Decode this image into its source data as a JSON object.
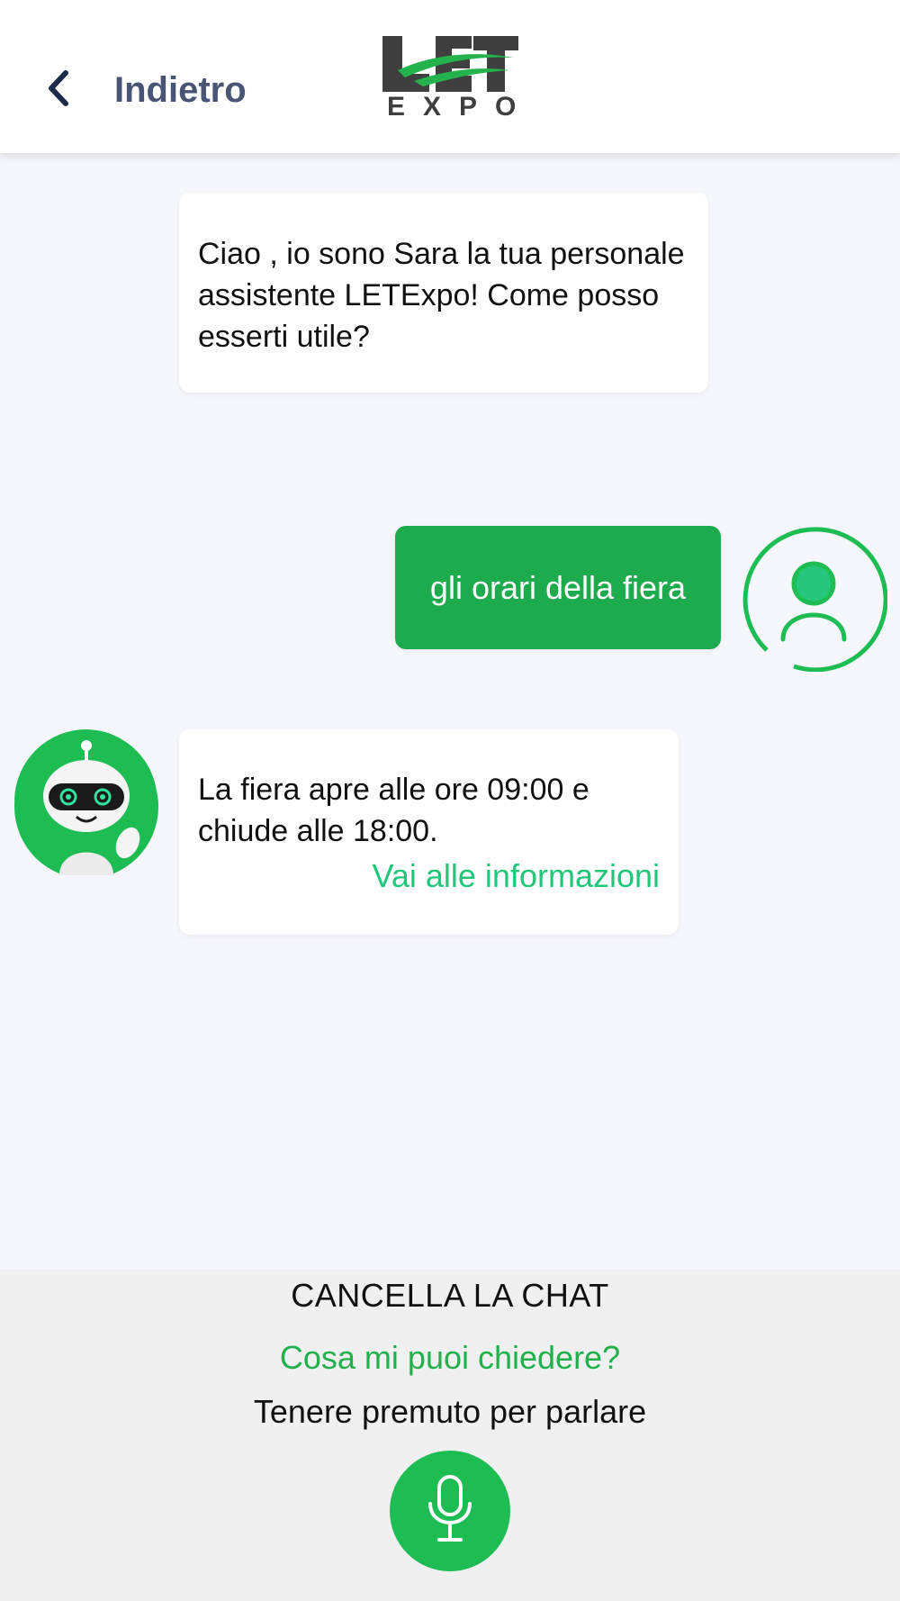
{
  "header": {
    "back_label": "Indietro",
    "logo_text": "LET",
    "logo_subtext": "EXPO"
  },
  "messages": [
    {
      "from": "bot",
      "text": "Ciao , io sono Sara la tua personale assistente LETExpo! Come posso esserti utile?"
    },
    {
      "from": "user",
      "text": "gli orari della fiera"
    },
    {
      "from": "bot",
      "text": "La fiera apre alle ore 09:00 e chiude alle 18:00.",
      "link": "Vai alle informazioni"
    }
  ],
  "footer": {
    "clear_chat": "CANCELLA LA CHAT",
    "ask_prompt": "Cosa mi puoi chiedere?",
    "hold_to_talk": "Tenere premuto per parlare",
    "mic_icon": "microphone-icon"
  },
  "colors": {
    "brand_green": "#1dab4e",
    "link_green": "#20c77b",
    "header_text": "#4a5575",
    "background": "#f6f7fc"
  }
}
